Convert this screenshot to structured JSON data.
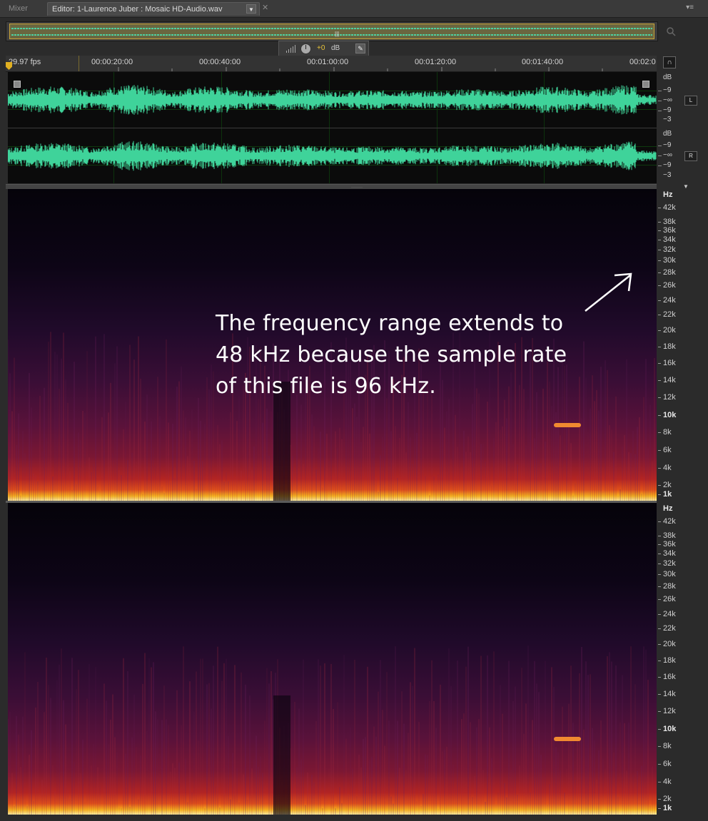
{
  "tabs": {
    "mixer": "Mixer",
    "editor": "Editor: 1-Laurence Juber : Mosaic HD-Audio.wav"
  },
  "hud": {
    "value": "+0",
    "unit": "dB"
  },
  "ruler": {
    "fps": "29.97 fps",
    "times": [
      "00:00:20:00",
      "00:00:40:00",
      "00:01:00:00",
      "00:01:20:00",
      "00:01:40:00",
      "00:02:0"
    ]
  },
  "channels": {
    "left": "L",
    "right": "R"
  },
  "db_scale": [
    "dB",
    "−9",
    "−∞",
    "−9",
    "−3"
  ],
  "hz_scale": [
    "Hz",
    "42k",
    "38k",
    "36k",
    "34k",
    "32k",
    "30k",
    "28k",
    "26k",
    "24k",
    "22k",
    "20k",
    "18k",
    "16k",
    "14k",
    "12k",
    "10k",
    "8k",
    "6k",
    "4k",
    "2k",
    "1k"
  ],
  "annotation": {
    "line1": "The frequency range extends to",
    "line2": "48 kHz because the sample rate",
    "line3": "of this file is 96 kHz."
  },
  "colors": {
    "waveform": "#3fd39a",
    "selection_border": "#c9a43a",
    "hud_value": "#e6c23a",
    "playhead": "#e0b021"
  }
}
